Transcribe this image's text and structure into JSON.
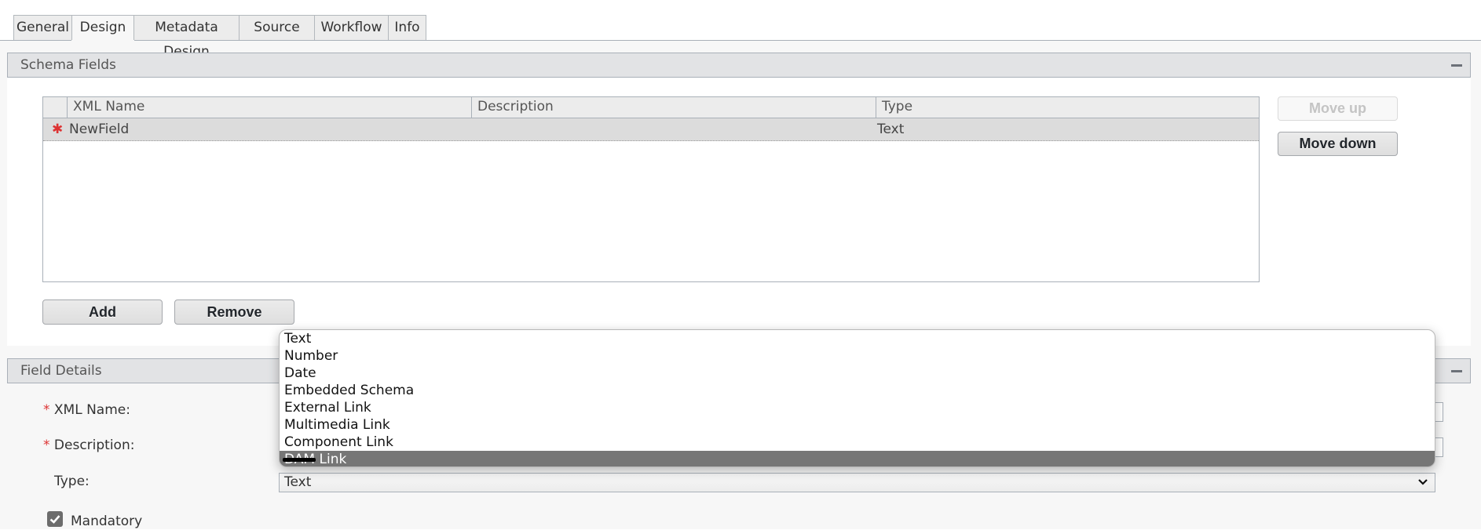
{
  "tabs": [
    {
      "label": "General",
      "active": false
    },
    {
      "label": "Design",
      "active": true
    },
    {
      "label": "Metadata Design",
      "active": false
    },
    {
      "label": "Source",
      "active": false
    },
    {
      "label": "Workflow",
      "active": false
    },
    {
      "label": "Info",
      "active": false
    }
  ],
  "schema_fields": {
    "title": "Schema Fields",
    "columns": [
      "XML Name",
      "Description",
      "Type"
    ],
    "rows": [
      {
        "required": true,
        "xml_name": "NewField",
        "description": "",
        "type": "Text"
      }
    ],
    "move_up_label": "Move up",
    "move_down_label": "Move down",
    "add_label": "Add",
    "remove_label": "Remove",
    "required_marker": "✱"
  },
  "field_details": {
    "title": "Field Details",
    "xml_name_label": "XML Name:",
    "description_label": "Description:",
    "type_label": "Type:",
    "type_value": "Text",
    "mandatory_label": "Mandatory",
    "mandatory_checked": true,
    "required_marker": "*"
  },
  "type_dropdown": {
    "options": [
      "Text",
      "Number",
      "Date",
      "Embedded Schema",
      "External Link",
      "Multimedia Link",
      "Component Link"
    ],
    "highlighted_prefix_redacted": "DAM",
    "highlighted_suffix": " Link"
  },
  "colors": {
    "required": "#dd3333",
    "highlight": "#767676",
    "panel_header": "#e2e3e5"
  }
}
